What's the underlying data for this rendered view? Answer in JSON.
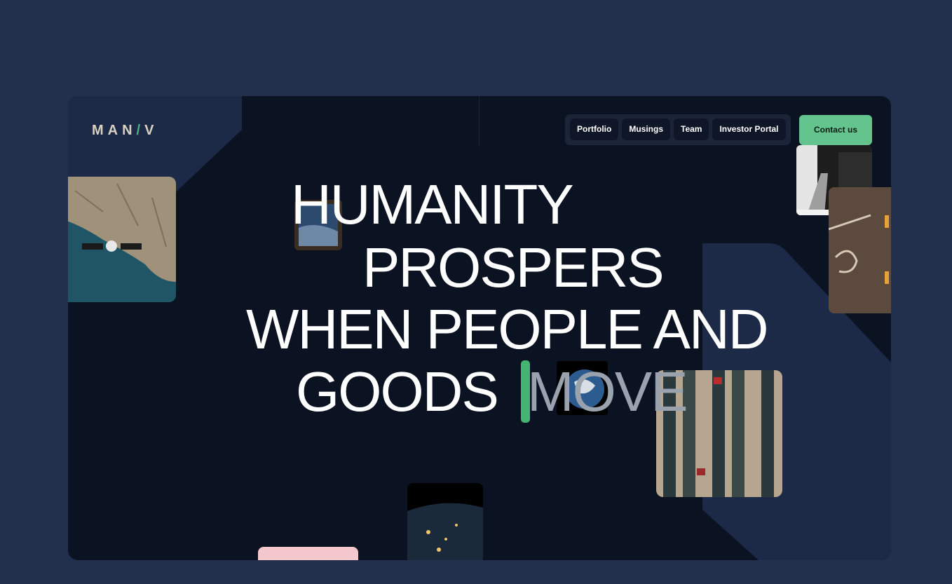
{
  "brand": {
    "logo_left": "MAN",
    "logo_slash": "/",
    "logo_right": "V"
  },
  "nav": {
    "items": [
      {
        "label": "Portfolio"
      },
      {
        "label": "Musings"
      },
      {
        "label": "Team"
      },
      {
        "label": "Investor Portal"
      }
    ],
    "contact_label": "Contact us"
  },
  "hero": {
    "line1": "HUMANITY",
    "line2": "PROSPERS",
    "line3": "WHEN PEOPLE AND",
    "line4_solid": "GOODS",
    "line4_dim": "MOVE"
  },
  "colors": {
    "page_bg": "#222f4d",
    "frame_bg": "#0b1222",
    "accent": "#64c48d",
    "cursor": "#43b472"
  }
}
